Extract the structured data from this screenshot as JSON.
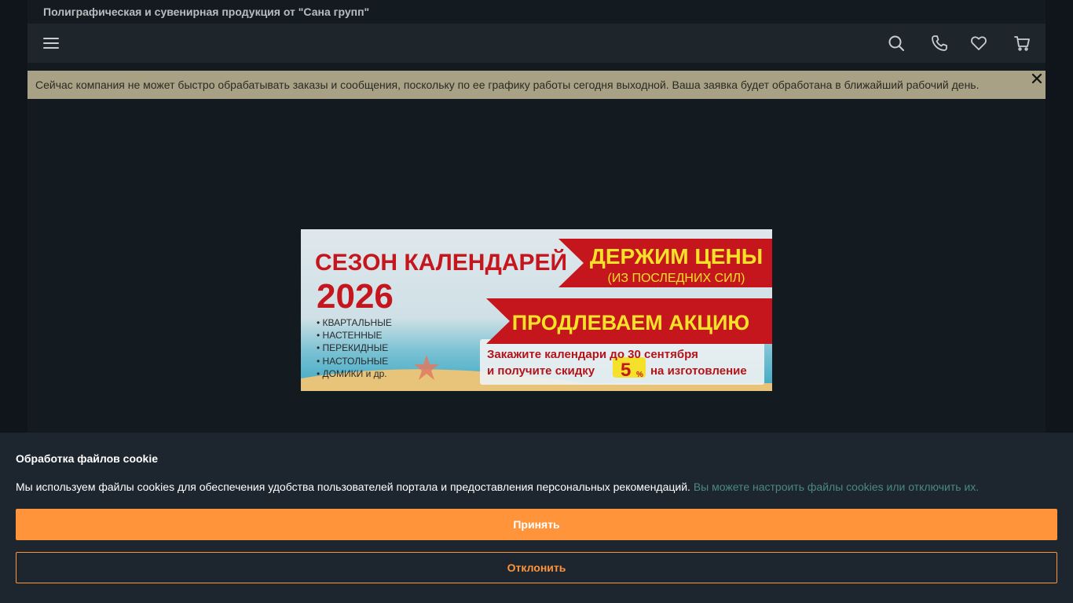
{
  "site": {
    "tagline": "Полиграфическая и сувенирная продукция от \"Сана групп\""
  },
  "nav": {
    "icons": [
      "menu-icon",
      "search-icon",
      "phone-icon",
      "heart-icon",
      "cart-icon"
    ]
  },
  "notice": {
    "text": "Сейчас компания не может быстро обрабатывать заказы и сообщения, поскольку по ее графику работы сегодня выходной. Ваша заявка будет обработана в ближайший рабочий день."
  },
  "banner": {
    "title_line1": "СЕЗОН КАЛЕНДАРЕЙ",
    "year": "2026",
    "list": [
      "• КВАРТАЛЬНЫЕ",
      "• НАСТЕННЫЕ",
      "• ПЕРЕКИДНЫЕ",
      "• НАСТОЛЬНЫЕ",
      "• ДОМИКИ и др."
    ],
    "ribbon1_main": "ДЕРЖИМ ЦЕНЫ",
    "ribbon1_sub": "(ИЗ ПОСЛЕДНИХ СИЛ)",
    "ribbon2": "ПРОДЛЕВАЕМ АКЦИЮ",
    "offer_line1": "Закажите календари до 30 сентября",
    "offer_line2_pre": "и получите скидку",
    "discount_num": "5",
    "discount_unit": "%",
    "offer_line2_post": "на изготовление"
  },
  "cookie": {
    "title": "Обработка файлов cookie",
    "text": "Мы используем файлы cookies для обеспечения удобства пользователей портала и предоставления персональных рекомендаций.",
    "link": "Вы можете настроить файлы cookies или отключить их.",
    "accept": "Принять",
    "decline": "Отклонить"
  },
  "colors": {
    "accent": "#ff943b",
    "notice_bg": "#a8a186",
    "banner_red": "#c4161c",
    "banner_yellow": "#f5e12a"
  }
}
